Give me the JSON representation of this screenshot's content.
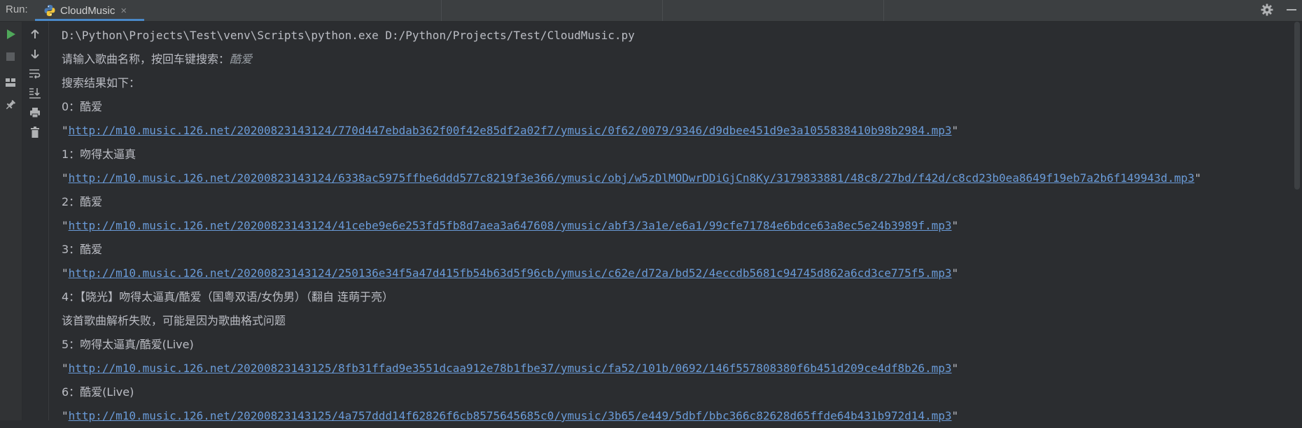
{
  "topbar": {
    "run_label": "Run:",
    "tab_title": "CloudMusic",
    "close_glyph": "×"
  },
  "icons": {
    "rerun": "play-icon",
    "stop": "stop-icon",
    "layout": "layout-icon",
    "pin": "pin-icon",
    "up": "arrow-up-icon",
    "down": "arrow-down-icon",
    "softwrap": "soft-wrap-icon",
    "scrollend": "scroll-to-end-icon",
    "print": "print-icon",
    "clear": "trash-icon",
    "settings": "gear-icon",
    "minimize": "minimize-icon"
  },
  "colors": {
    "accent": "#4a88c7",
    "run_green": "#4fa85a",
    "link": "#6a9bd8"
  },
  "console": {
    "command": "D:\\Python\\Projects\\Test\\venv\\Scripts\\python.exe D:/Python/Projects/Test/CloudMusic.py",
    "prompt": "请输入歌曲名称，按回车键搜索：",
    "user_input": "酷爱",
    "results_header": "搜索结果如下：",
    "entries": [
      {
        "title": "0：酷爱",
        "url": "http://m10.music.126.net/20200823143124/770d447ebdab362f00f42e85df2a02f7/ymusic/0f62/0079/9346/d9dbee451d9e3a1055838410b98b2984.mp3"
      },
      {
        "title": "1：吻得太逼真",
        "url": "http://m10.music.126.net/20200823143124/6338ac5975ffbe6ddd577c8219f3e366/ymusic/obj/w5zDlMODwrDDiGjCn8Ky/3179833881/48c8/27bd/f42d/c8cd23b0ea8649f19eb7a2b6f149943d.mp3"
      },
      {
        "title": "2：酷爱",
        "url": "http://m10.music.126.net/20200823143124/41cebe9e6e253fd5fb8d7aea3a647608/ymusic/abf3/3a1e/e6a1/99cfe71784e6bdce63a8ec5e24b3989f.mp3"
      },
      {
        "title": "3：酷爱",
        "url": "http://m10.music.126.net/20200823143124/250136e34f5a47d415fb54b63d5f96cb/ymusic/c62e/d72a/bd52/4eccdb5681c94745d862a6cd3ce775f5.mp3"
      },
      {
        "title": "4：【晓光】吻得太逼真/酷爱（国粤双语/女伪男）（翻自 连萌于亮）",
        "error": "该首歌曲解析失败，可能是因为歌曲格式问题"
      },
      {
        "title": "5：吻得太逼真/酷爱(Live)",
        "url": "http://m10.music.126.net/20200823143125/8fb31ffad9e3551dcaa912e78b1fbe37/ymusic/fa52/101b/0692/146f557808380f6b451d209ce4df8b26.mp3"
      },
      {
        "title": "6：酷爱(Live)",
        "url": "http://m10.music.126.net/20200823143125/4a757ddd14f62826f6cb8575645685c0/ymusic/3b65/e449/5dbf/bbc366c82628d65ffde64b431b972d14.mp3"
      }
    ]
  }
}
